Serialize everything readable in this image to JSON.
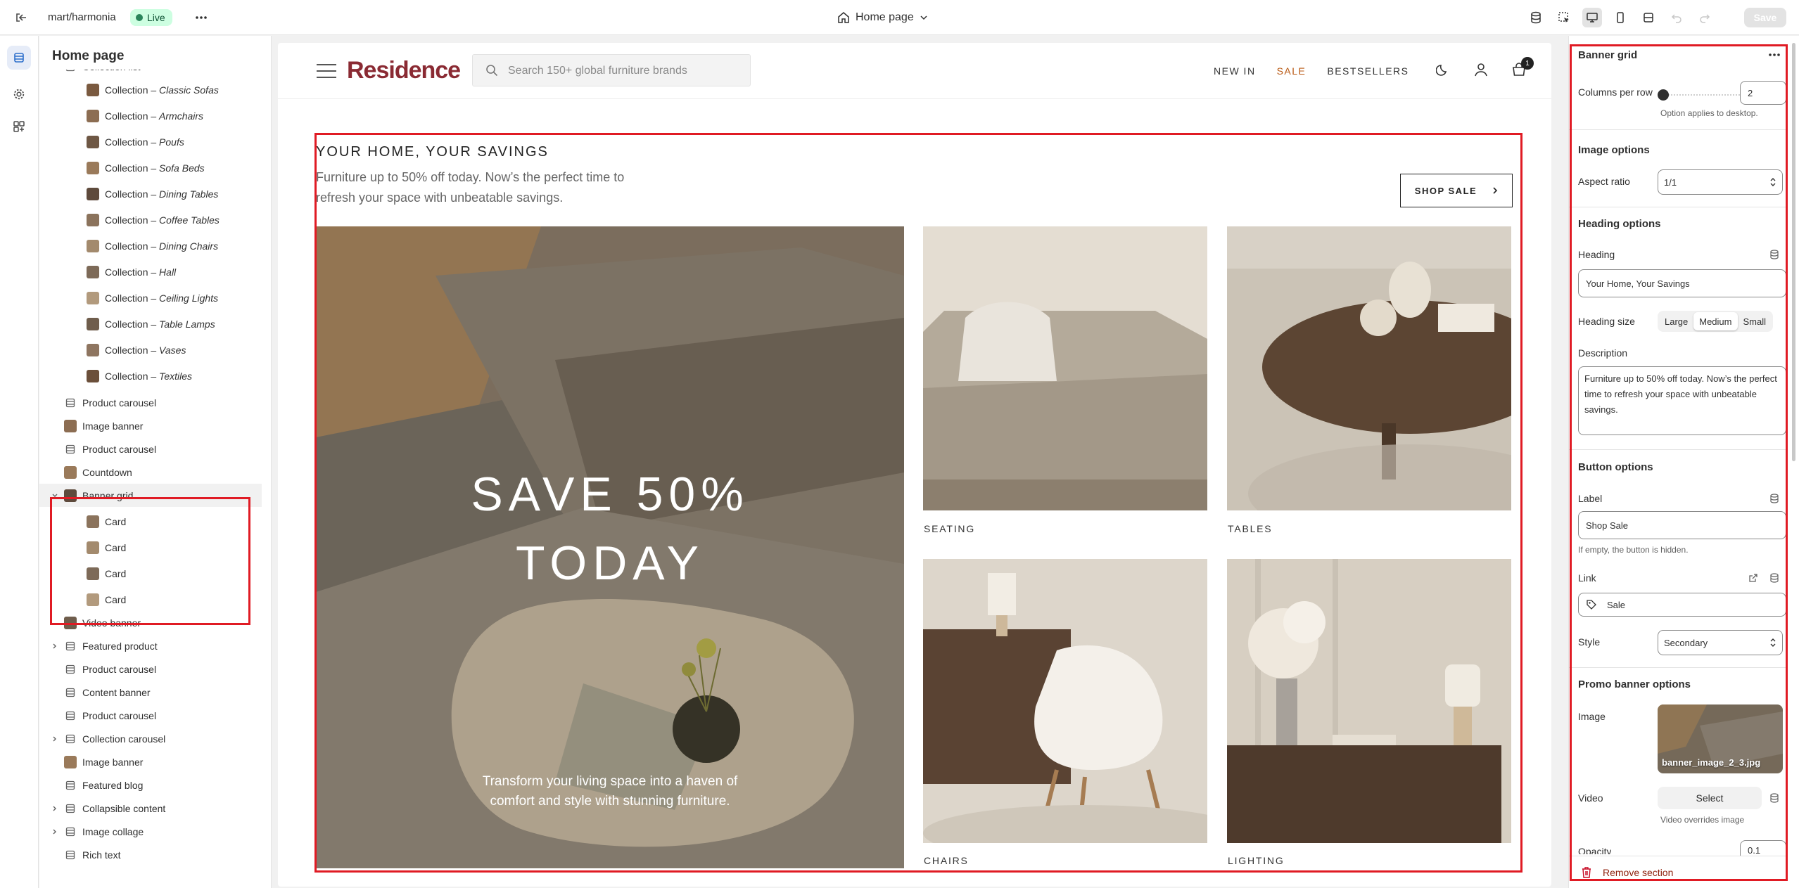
{
  "topbar": {
    "store_name": "mart/harmonia",
    "status_badge": "Live",
    "page_selector": "Home page",
    "save_label": "Save"
  },
  "left_panel": {
    "title": "Home page",
    "items": [
      {
        "label": "Collection list",
        "italic": ""
      },
      {
        "label": "Collection – ",
        "italic": "Classic Sofas"
      },
      {
        "label": "Collection – ",
        "italic": "Armchairs"
      },
      {
        "label": "Collection – ",
        "italic": "Poufs"
      },
      {
        "label": "Collection – ",
        "italic": "Sofa Beds"
      },
      {
        "label": "Collection – ",
        "italic": "Dining Tables"
      },
      {
        "label": "Collection – ",
        "italic": "Coffee Tables"
      },
      {
        "label": "Collection – ",
        "italic": "Dining Chairs"
      },
      {
        "label": "Collection – ",
        "italic": "Hall"
      },
      {
        "label": "Collection – ",
        "italic": "Ceiling Lights"
      },
      {
        "label": "Collection – ",
        "italic": "Table Lamps"
      },
      {
        "label": "Collection – ",
        "italic": "Vases"
      },
      {
        "label": "Collection – ",
        "italic": "Textiles"
      },
      {
        "label": "Product carousel",
        "italic": ""
      },
      {
        "label": "Image banner",
        "italic": ""
      },
      {
        "label": "Product carousel",
        "italic": ""
      },
      {
        "label": "Countdown",
        "italic": ""
      },
      {
        "label": "Banner grid",
        "italic": ""
      },
      {
        "label": "Card",
        "italic": ""
      },
      {
        "label": "Card",
        "italic": ""
      },
      {
        "label": "Card",
        "italic": ""
      },
      {
        "label": "Card",
        "italic": ""
      },
      {
        "label": "Video banner",
        "italic": ""
      },
      {
        "label": "Featured product",
        "italic": ""
      },
      {
        "label": "Product carousel",
        "italic": ""
      },
      {
        "label": "Content banner",
        "italic": ""
      },
      {
        "label": "Product carousel",
        "italic": ""
      },
      {
        "label": "Collection carousel",
        "italic": ""
      },
      {
        "label": "Image banner",
        "italic": ""
      },
      {
        "label": "Featured blog",
        "italic": ""
      },
      {
        "label": "Collapsible content",
        "italic": ""
      },
      {
        "label": "Image collage",
        "italic": ""
      },
      {
        "label": "Rich text",
        "italic": ""
      }
    ]
  },
  "site": {
    "brand": "Residence",
    "search_placeholder": "Search 150+ global furniture brands",
    "nav": [
      "NEW IN",
      "SALE",
      "BESTSELLERS"
    ],
    "cart_count": "1"
  },
  "banner_grid": {
    "title": "YOUR HOME, YOUR SAVINGS",
    "description": "Furniture up to 50% off today. Now’s the perfect time to refresh your space with unbeatable savings.",
    "button_label": "SHOP SALE",
    "promo_heading_line1": "SAVE 50%",
    "promo_heading_line2": "TODAY",
    "promo_subtext": "Transform your living space into a haven of comfort and style with stunning furniture.",
    "cards": [
      "SEATING",
      "TABLES",
      "CHAIRS",
      "LIGHTING"
    ]
  },
  "settings": {
    "section_title": "Banner grid",
    "columns_label": "Columns per row",
    "columns_value": "2",
    "columns_help": "Option applies to desktop.",
    "image_options": "Image options",
    "aspect_label": "Aspect ratio",
    "aspect_value": "1/1",
    "heading_options": "Heading options",
    "heading_label": "Heading",
    "heading_value": "Your Home, Your Savings",
    "heading_size_label": "Heading size",
    "heading_sizes": [
      "Large",
      "Medium",
      "Small"
    ],
    "heading_size_selected": "Medium",
    "description_label": "Description",
    "description_value": "Furniture up to 50% off today. Now’s the perfect time to refresh your space with unbeatable savings.",
    "button_options": "Button options",
    "label_label": "Label",
    "label_value": "Shop Sale",
    "label_help": "If empty, the button is hidden.",
    "link_label": "Link",
    "link_value": "Sale",
    "style_label": "Style",
    "style_value": "Secondary",
    "promo_options": "Promo banner options",
    "image_label": "Image",
    "image_file": "banner_image_2_3.jpg",
    "video_label": "Video",
    "video_select": "Select",
    "video_help": "Video overrides image",
    "opacity_label": "Opacity",
    "opacity_value": "0.1",
    "remove_label": "Remove section"
  },
  "colors": {
    "accent": "#2c6ecb",
    "highlight": "#e01b24",
    "brand": "#8a2a33",
    "sale": "#b8560f",
    "live_badge_bg": "#cdfee1"
  }
}
